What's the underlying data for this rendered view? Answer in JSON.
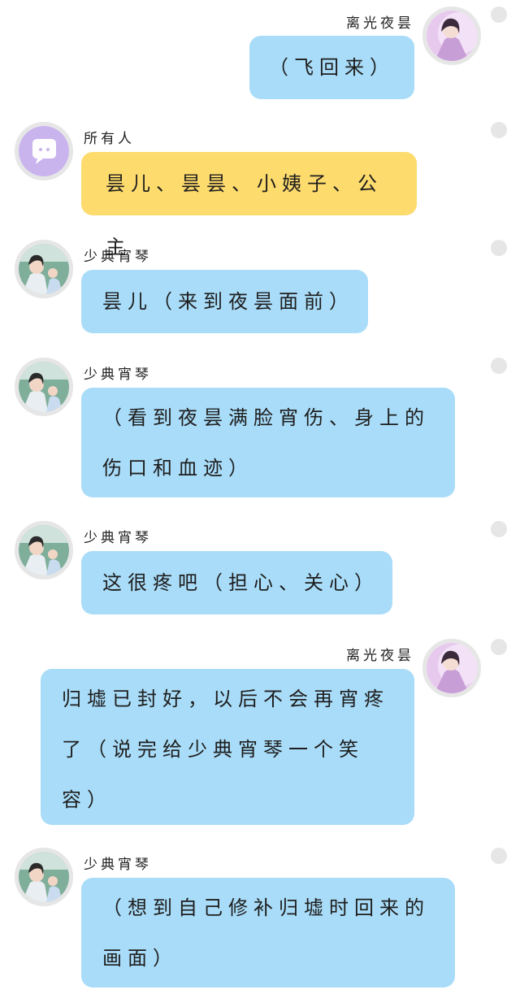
{
  "messages": [
    {
      "sender": "离光夜昙",
      "side": "right",
      "avatar": "avatar-lady",
      "bubble_color": "#a9dcf8",
      "lines": [
        "（飞回来）"
      ]
    },
    {
      "sender": "所有人",
      "side": "left",
      "avatar": "avatar-chat-bubble",
      "bubble_color": "#fddb6d",
      "lines": [
        "昙儿、昙昙、小姨子、公主"
      ]
    },
    {
      "sender": "少典宵琴",
      "side": "left",
      "avatar": "avatar-man",
      "bubble_color": "#a9dcf8",
      "lines": [
        "昙儿（来到夜昙面前）"
      ]
    },
    {
      "sender": "少典宵琴",
      "side": "left",
      "avatar": "avatar-man",
      "bubble_color": "#a9dcf8",
      "lines": [
        "（看到夜昙满脸宵伤、身上的",
        "伤口和血迹）"
      ]
    },
    {
      "sender": "少典宵琴",
      "side": "left",
      "avatar": "avatar-man",
      "bubble_color": "#a9dcf8",
      "lines": [
        "这很疼吧（担心、关心）"
      ]
    },
    {
      "sender": "离光夜昙",
      "side": "right",
      "avatar": "avatar-lady",
      "bubble_color": "#a9dcf8",
      "lines": [
        "归墟已封好，以后不会再宵疼",
        "了（说完给少典宵琴一个笑",
        "容）"
      ]
    },
    {
      "sender": "少典宵琴",
      "side": "left",
      "avatar": "avatar-man",
      "bubble_color": "#a9dcf8",
      "lines": [
        "（想到自己修补归墟时回来的",
        "画面）"
      ]
    }
  ]
}
